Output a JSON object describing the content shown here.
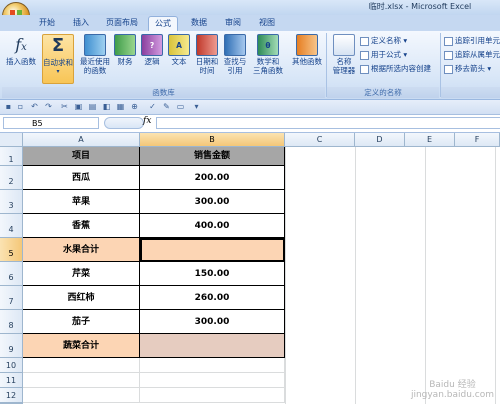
{
  "window": {
    "title": "临时.xlsx - Microsoft Excel"
  },
  "tabs": [
    "开始",
    "插入",
    "页面布局",
    "公式",
    "数据",
    "审阅",
    "视图"
  ],
  "active_tab": "公式",
  "ribbon": {
    "function_library": {
      "label": "函数库",
      "insert_function": "插入函数",
      "autosum": "自动求和",
      "recent": [
        "最近使用",
        "的函数"
      ],
      "financial": "财务",
      "logical": "逻辑",
      "text": "文本",
      "datetime": [
        "日期和",
        "时间"
      ],
      "lookup": [
        "查找与",
        "引用"
      ],
      "math": [
        "数学和",
        "三角函数"
      ],
      "more": "其他函数"
    },
    "defined_names": {
      "label": "定义的名称",
      "name_manager": [
        "名称",
        "管理器"
      ],
      "define_name": "定义名称",
      "use_in_formula": "用于公式",
      "create_from_selection": "根据所选内容创建"
    },
    "formula_auditing": {
      "trace_precedents": "追踪引用单元",
      "trace_dependents": "追踪从属单元",
      "remove_arrows": "移去箭头"
    }
  },
  "formula_bar": {
    "name_box": "B5",
    "fx": "fx",
    "content": ""
  },
  "columns": [
    "A",
    "B",
    "C",
    "D",
    "E",
    "F"
  ],
  "rows": [
    "1",
    "2",
    "3",
    "4",
    "5",
    "6",
    "7",
    "8",
    "9",
    "10",
    "11",
    "12",
    "13"
  ],
  "sheet": {
    "header": {
      "a": "项目",
      "b": "销售金额"
    },
    "data": [
      {
        "a": "西瓜",
        "b": "200.00"
      },
      {
        "a": "苹果",
        "b": "300.00"
      },
      {
        "a": "香蕉",
        "b": "400.00"
      },
      {
        "a": "水果合计",
        "b": ""
      },
      {
        "a": "芹菜",
        "b": "150.00"
      },
      {
        "a": "西红柿",
        "b": "260.00"
      },
      {
        "a": "茄子",
        "b": "300.00"
      },
      {
        "a": "蔬菜合计",
        "b": ""
      }
    ]
  },
  "watermark": {
    "line1": "Baidu 经验",
    "line2": "jingyan.baidu.com"
  },
  "colors": {
    "header_fill": "#a6a6a6",
    "subtotal_fill": "#fcd5b4",
    "ribbon_bg": "#d8e6f7"
  }
}
